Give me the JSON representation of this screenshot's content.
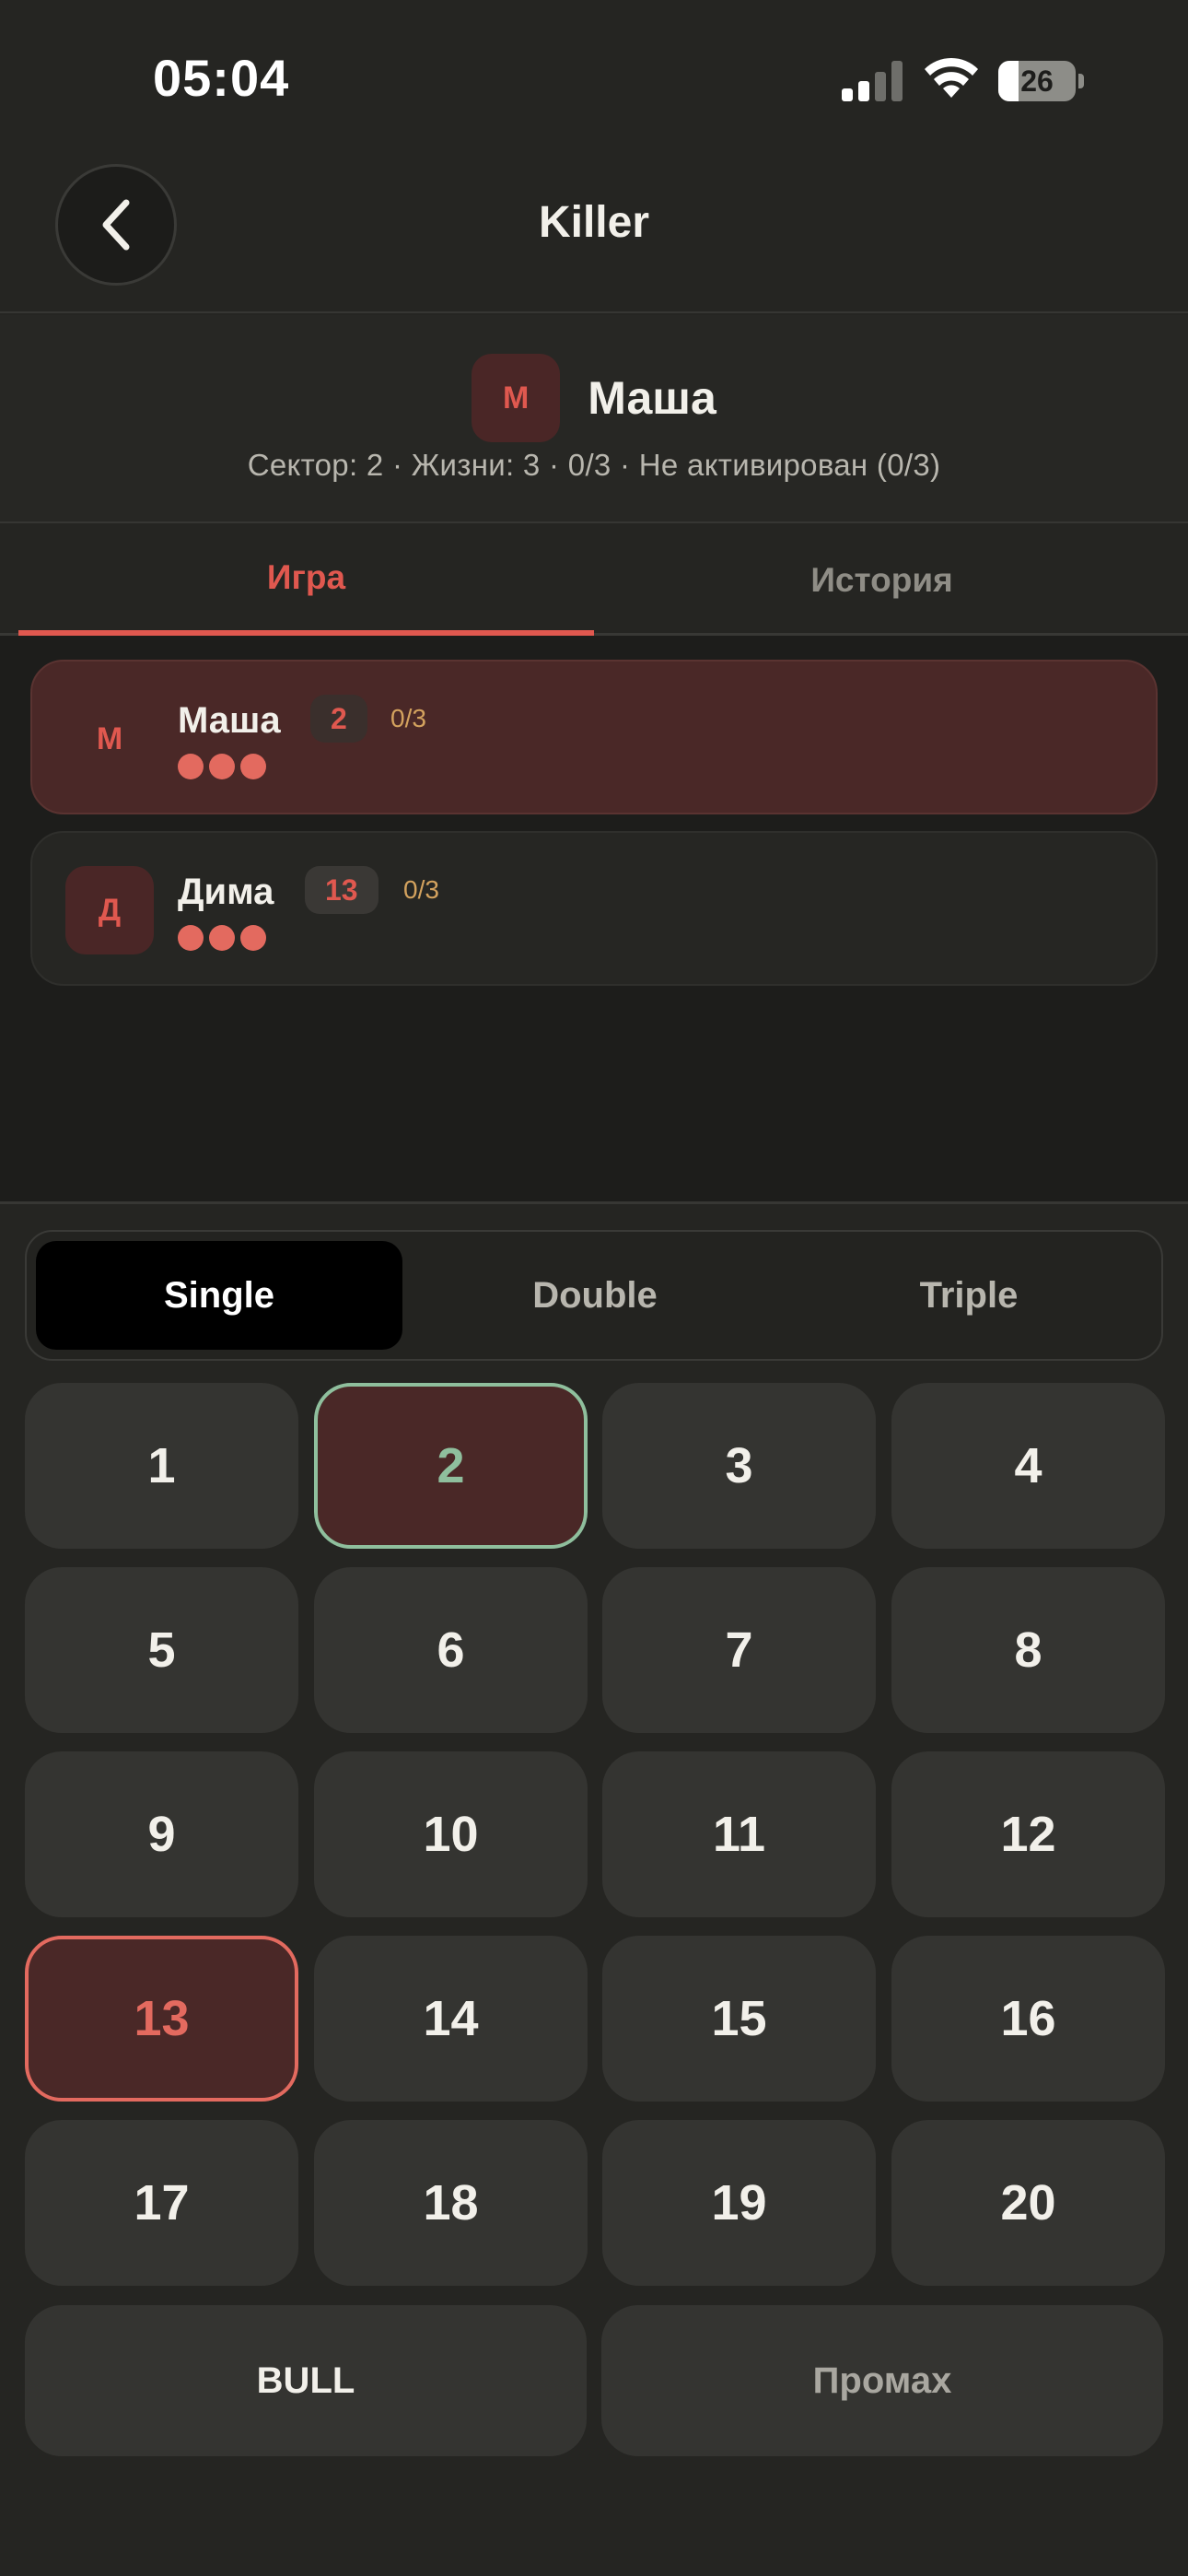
{
  "status_bar": {
    "time": "05:04",
    "battery": "26",
    "battery_fraction": 0.26
  },
  "nav": {
    "title": "Killer"
  },
  "current_player": {
    "initial": "М",
    "name": "Маша",
    "info": "Сектор: 2 · Жизни: 3 · 0/3 · Не активирован (0/3)"
  },
  "tabs": [
    {
      "label": "Игра",
      "active": true
    },
    {
      "label": "История",
      "active": false
    }
  ],
  "players": [
    {
      "initial": "М",
      "name": "Маша",
      "sector": "2",
      "hits": "0/3",
      "lives": 3,
      "active": true
    },
    {
      "initial": "Д",
      "name": "Дима",
      "sector": "13",
      "hits": "0/3",
      "lives": 3,
      "active": false
    }
  ],
  "multiplier": {
    "options": [
      "Single",
      "Double",
      "Triple"
    ],
    "selected": "Single"
  },
  "keypad": {
    "numbers": [
      "1",
      "2",
      "3",
      "4",
      "5",
      "6",
      "7",
      "8",
      "9",
      "10",
      "11",
      "12",
      "13",
      "14",
      "15",
      "16",
      "17",
      "18",
      "19",
      "20"
    ],
    "own_target": "2",
    "opponent_target": "13",
    "bull_label": "BULL",
    "miss_label": "Промах"
  },
  "colors": {
    "accent": "#e0584f",
    "own_target_border": "#8fbf9d",
    "active_card_bg": "#4a2827",
    "hits_color": "#d3a25e"
  }
}
